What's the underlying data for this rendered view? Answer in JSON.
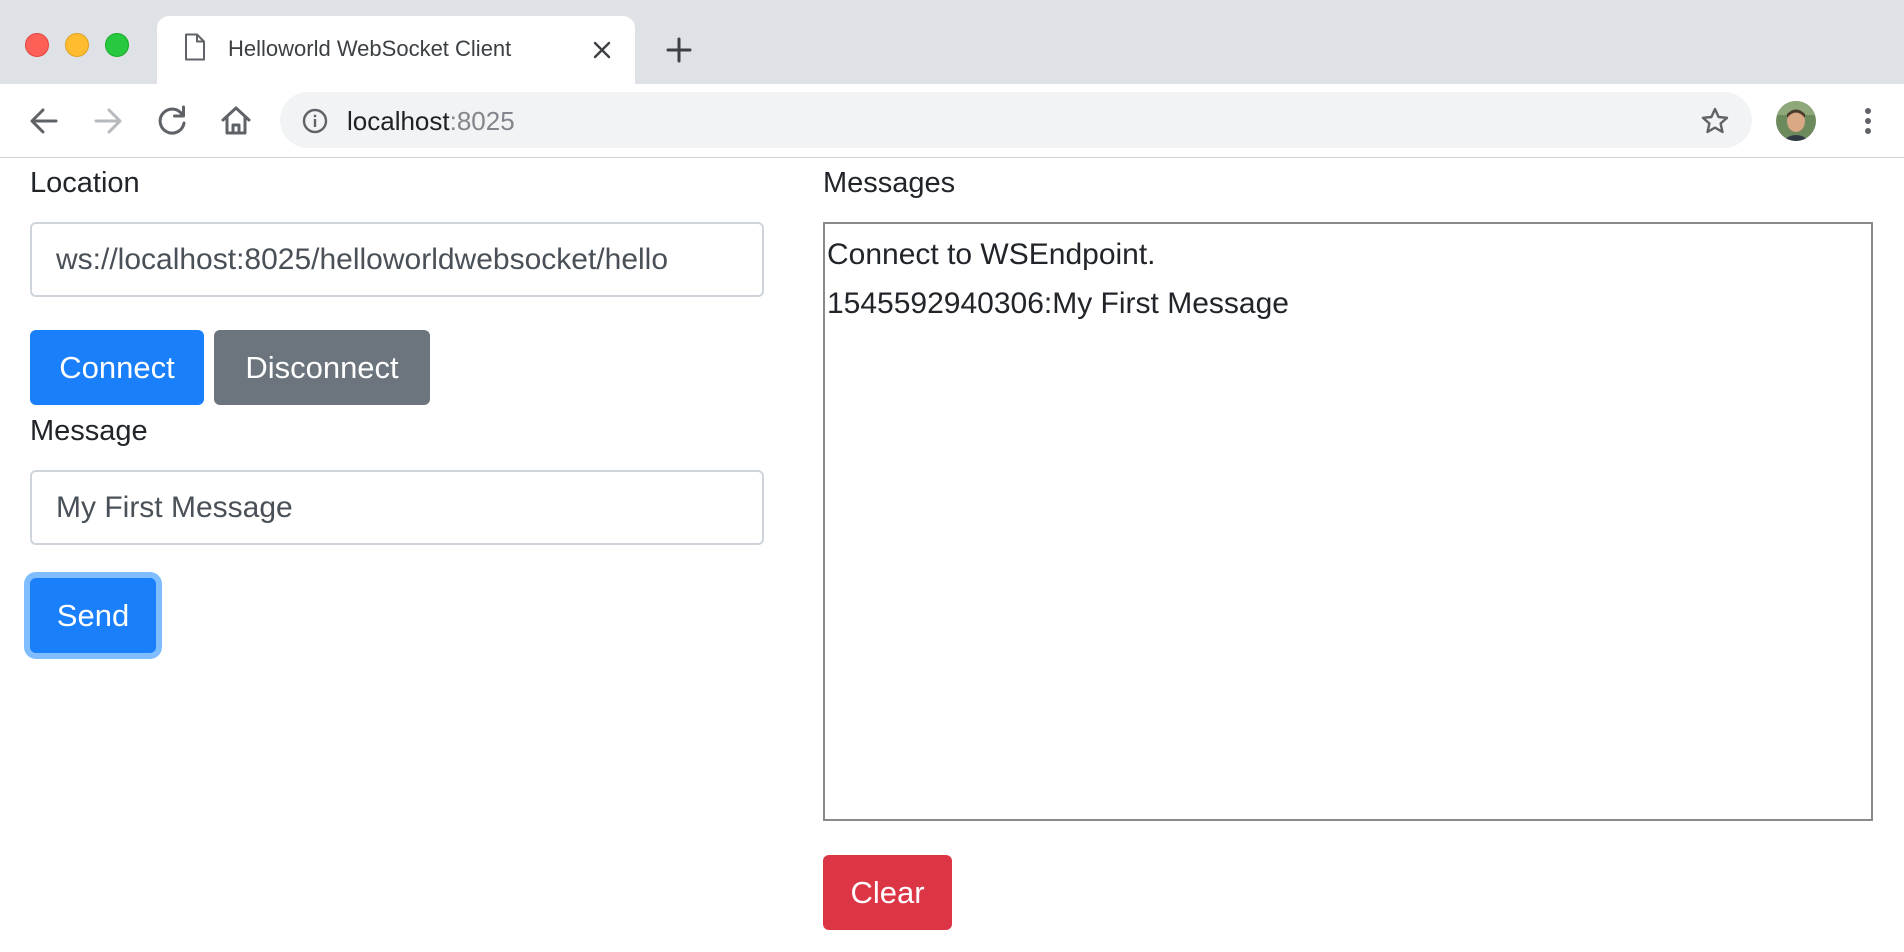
{
  "browser": {
    "tab": {
      "title": "Helloworld WebSocket Client"
    },
    "address": {
      "host": "localhost",
      "port": ":8025"
    }
  },
  "page": {
    "location": {
      "label": "Location",
      "value": "ws://localhost:8025/helloworldwebsocket/hello"
    },
    "connect_label": "Connect",
    "disconnect_label": "Disconnect",
    "message": {
      "label": "Message",
      "value": "My First Message"
    },
    "send_label": "Send",
    "messages": {
      "label": "Messages",
      "lines": [
        "Connect to WSEndpoint.",
        "1545592940306:My First Message"
      ]
    },
    "clear_label": "Clear"
  },
  "colors": {
    "primary": "#1a7ffb",
    "secondary": "#6c757d",
    "danger": "#dc3545",
    "focus_ring": "#80bdff",
    "chrome_frame": "#dee1e6"
  },
  "icons": {
    "tab": "document-icon",
    "close": "close-icon",
    "new_tab": "plus-icon",
    "back": "back-arrow-icon",
    "forward": "forward-arrow-icon",
    "reload": "reload-icon",
    "home": "home-icon",
    "site_info": "info-icon",
    "bookmark": "star-icon",
    "menu": "kebab-menu-icon"
  }
}
